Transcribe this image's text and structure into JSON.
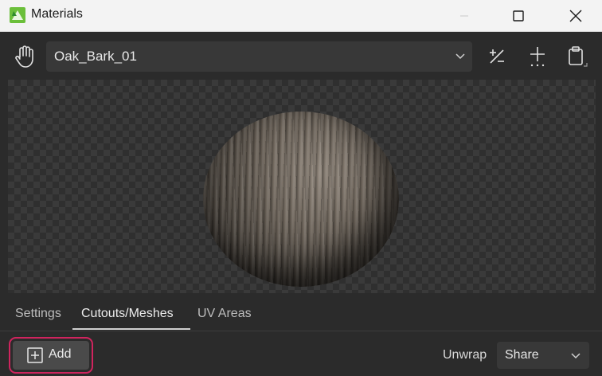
{
  "window": {
    "title": "Materials",
    "app_icon": "green-leaf-app-icon",
    "controls": [
      "minimize-icon",
      "maximize-icon",
      "close-icon"
    ]
  },
  "toolbar": {
    "material_select_value": "Oak_Bark_01",
    "icons": [
      "hand-icon",
      "chevron-down-icon",
      "plus-minus-icon",
      "add-icon",
      "clipboard-icon"
    ]
  },
  "preview": {
    "subject": "bark-textured material sphere"
  },
  "tabs": {
    "items": [
      "Settings",
      "Cutouts/Meshes",
      "UV Areas"
    ],
    "active": "Cutouts/Meshes"
  },
  "bottom": {
    "add_label": "Add",
    "unwrap_label": "Unwrap",
    "unwrap_value": "Share"
  },
  "colors": {
    "background": "#2b2b2b",
    "titlebar": "#f3f3f3",
    "highlight_outline": "#d0245e"
  }
}
